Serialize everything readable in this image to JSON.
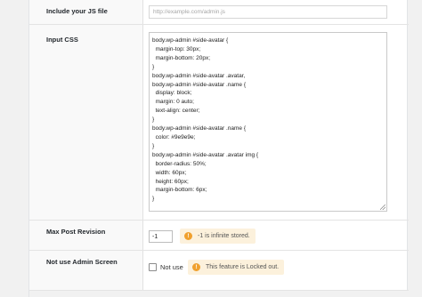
{
  "settings": {
    "js_file": {
      "label": "Include your JS file",
      "placeholder": "http://example.com/admin.js",
      "value": ""
    },
    "input_css": {
      "label": "Input CSS",
      "value": "body.wp-admin #side-avatar {\n  margin-top: 30px;\n  margin-bottom: 20px;\n}\nbody.wp-admin #side-avatar .avatar,\nbody.wp-admin #side-avatar .name {\n  display: block;\n  margin: 0 auto;\n  text-align: center;\n}\nbody.wp-admin #side-avatar .name {\n  color: #9e9e9e;\n}\nbody.wp-admin #side-avatar .avatar img {\n  border-radius: 50%;\n  width: 60px;\n  height: 60px;\n  margin-bottom: 6px;\n}"
    },
    "max_post_revision": {
      "label": "Max Post Revision",
      "value": "-1",
      "notice": "-1 is infinite stored."
    },
    "admin_screen": {
      "label": "Not use Admin Screen",
      "checkbox_label": "Not use",
      "checked": false,
      "notice": "This feature is Locked out."
    }
  },
  "icons": {
    "notice_icon": "warning-circle-icon"
  },
  "colors": {
    "notice_bg": "#fcf1dc",
    "notice_icon": "#f0a02d",
    "label_column_bg": "#f9f9f9",
    "page_bg": "#f1f1f1"
  }
}
